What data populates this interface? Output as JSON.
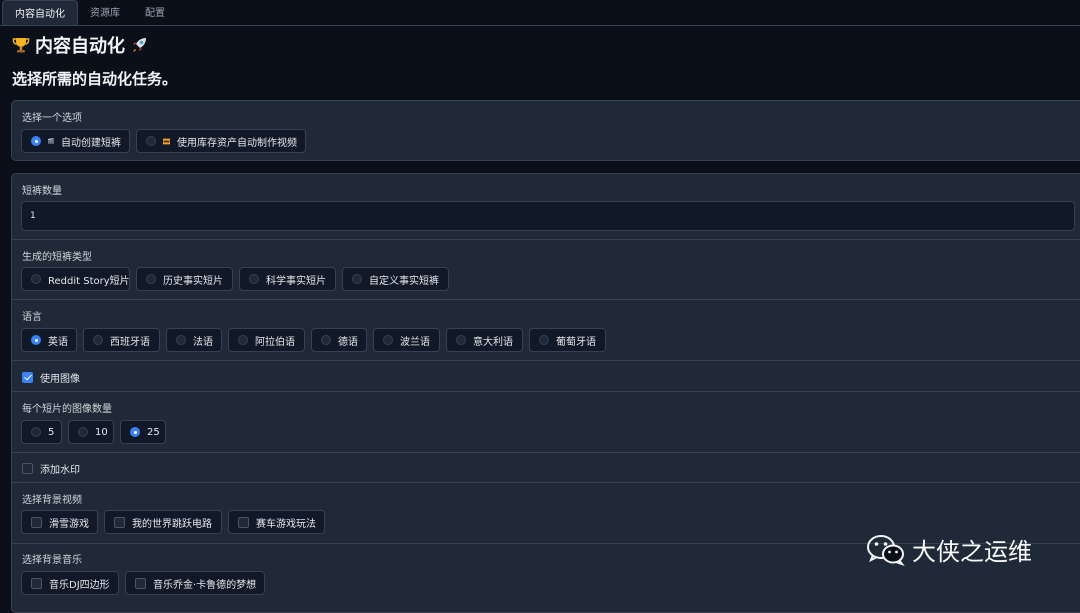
{
  "tabs": [
    "内容自动化",
    "资源库",
    "配置"
  ],
  "title": "内容自动化",
  "subtitle": "选择所需的自动化任务。",
  "mode": {
    "label": "选择一个选项",
    "options": [
      {
        "label": "自动创建短裤",
        "icon": "clapper-board-icon",
        "selected": true
      },
      {
        "label": "使用库存资产自动制作视频",
        "icon": "film-strip-icon",
        "selected": false
      }
    ]
  },
  "count": {
    "label": "短裤数量",
    "value": "1"
  },
  "short_type": {
    "label": "生成的短裤类型",
    "options": [
      "Reddit Story短片",
      "历史事实短片",
      "科学事实短片",
      "自定义事实短裤"
    ]
  },
  "language": {
    "label": "语言",
    "options": [
      "英语",
      "西班牙语",
      "法语",
      "阿拉伯语",
      "德语",
      "波兰语",
      "意大利语",
      "葡萄牙语"
    ],
    "selected": "英语"
  },
  "use_images": {
    "label": "使用图像",
    "checked": true
  },
  "images_per_short": {
    "label": "每个短片的图像数量",
    "options": [
      "5",
      "10",
      "25"
    ],
    "selected": "25"
  },
  "watermark": {
    "label": "添加水印",
    "checked": false
  },
  "bg_video": {
    "label": "选择背景视频",
    "options": [
      "滑雪游戏",
      "我的世界跳跃电路",
      "赛车游戏玩法"
    ]
  },
  "bg_music": {
    "label": "选择背景音乐",
    "options": [
      "音乐DJ四边形",
      "音乐乔金·卡鲁德的梦想"
    ]
  },
  "watermark_brand": {
    "text": "大侠之运维",
    "icon": "wechat-icon"
  },
  "colors": {
    "accent": "#3b82f6",
    "background": "#0b0f19",
    "panel": "#1f2937"
  }
}
